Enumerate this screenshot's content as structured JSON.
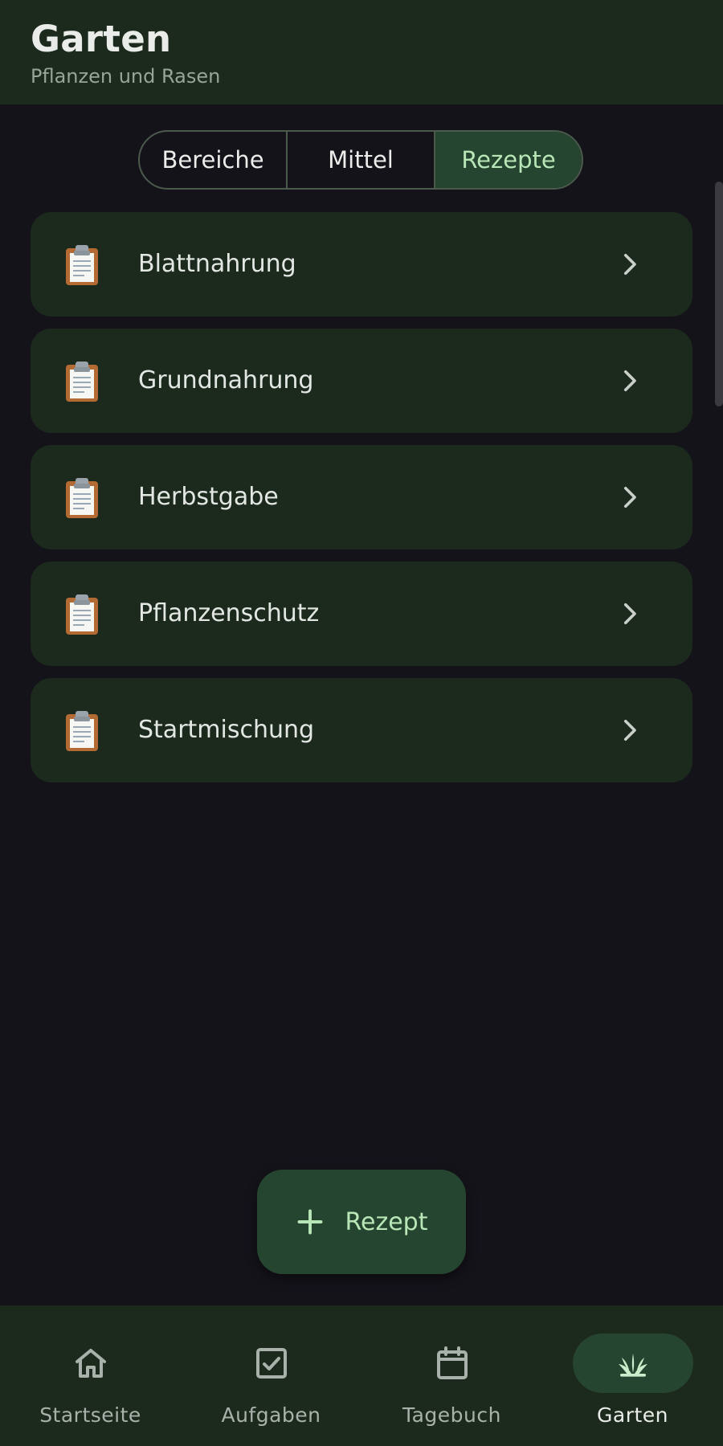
{
  "header": {
    "title": "Garten",
    "subtitle": "Pflanzen und Rasen"
  },
  "tabs": [
    {
      "label": "Bereiche",
      "active": false
    },
    {
      "label": "Mittel",
      "active": false
    },
    {
      "label": "Rezepte",
      "active": true
    }
  ],
  "recipes": [
    {
      "label": "Blattnahrung",
      "icon": "clipboard-icon"
    },
    {
      "label": "Grundnahrung",
      "icon": "clipboard-icon"
    },
    {
      "label": "Herbstgabe",
      "icon": "clipboard-icon"
    },
    {
      "label": "Pflanzenschutz",
      "icon": "clipboard-icon"
    },
    {
      "label": "Startmischung",
      "icon": "clipboard-icon"
    }
  ],
  "fab": {
    "label": "Rezept",
    "icon": "plus-icon"
  },
  "bottom_nav": [
    {
      "label": "Startseite",
      "icon": "home-icon",
      "active": false
    },
    {
      "label": "Aufgaben",
      "icon": "checkbox-icon",
      "active": false
    },
    {
      "label": "Tagebuch",
      "icon": "calendar-icon",
      "active": false
    },
    {
      "label": "Garten",
      "icon": "plant-icon",
      "active": true
    }
  ],
  "colors": {
    "background": "#15131a",
    "surface": "#1c2a1e",
    "accent_container": "#264530",
    "accent_text": "#b8e6b6"
  }
}
